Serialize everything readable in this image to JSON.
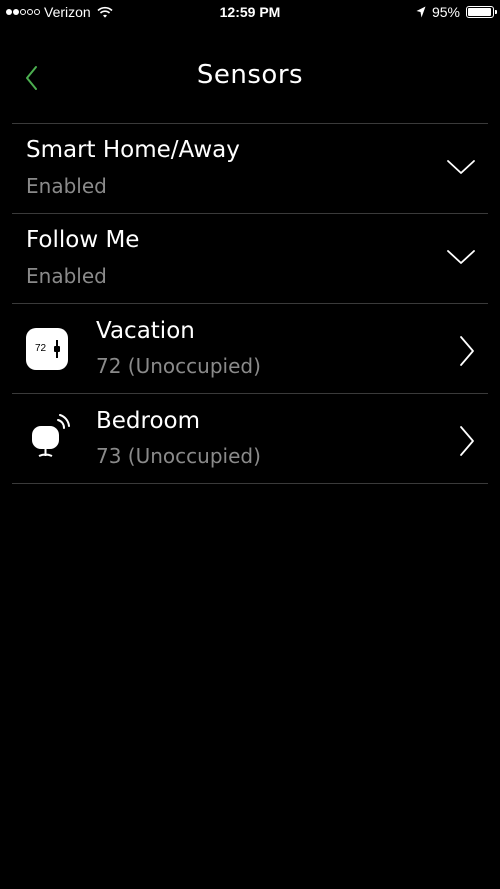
{
  "status_bar": {
    "signal_filled": 2,
    "signal_total": 5,
    "carrier": "Verizon",
    "time": "12:59 PM",
    "battery_text": "95%",
    "battery_level": 0.95
  },
  "nav": {
    "back_icon": "chevron-left-icon",
    "title": "Sensors",
    "accent_color": "#4caf50"
  },
  "rows": [
    {
      "title": "Smart Home/Away",
      "subtitle": "Enabled",
      "icon": "chevron-down-icon"
    },
    {
      "title": "Follow Me",
      "subtitle": "Enabled",
      "icon": "chevron-down-icon"
    }
  ],
  "sensors": [
    {
      "name": "Vacation",
      "status": "72 (Unoccupied)",
      "icon": "thermostat-icon",
      "thermostat_label": "72"
    },
    {
      "name": "Bedroom",
      "status": "73 (Unoccupied)",
      "icon": "room-sensor-icon"
    }
  ]
}
